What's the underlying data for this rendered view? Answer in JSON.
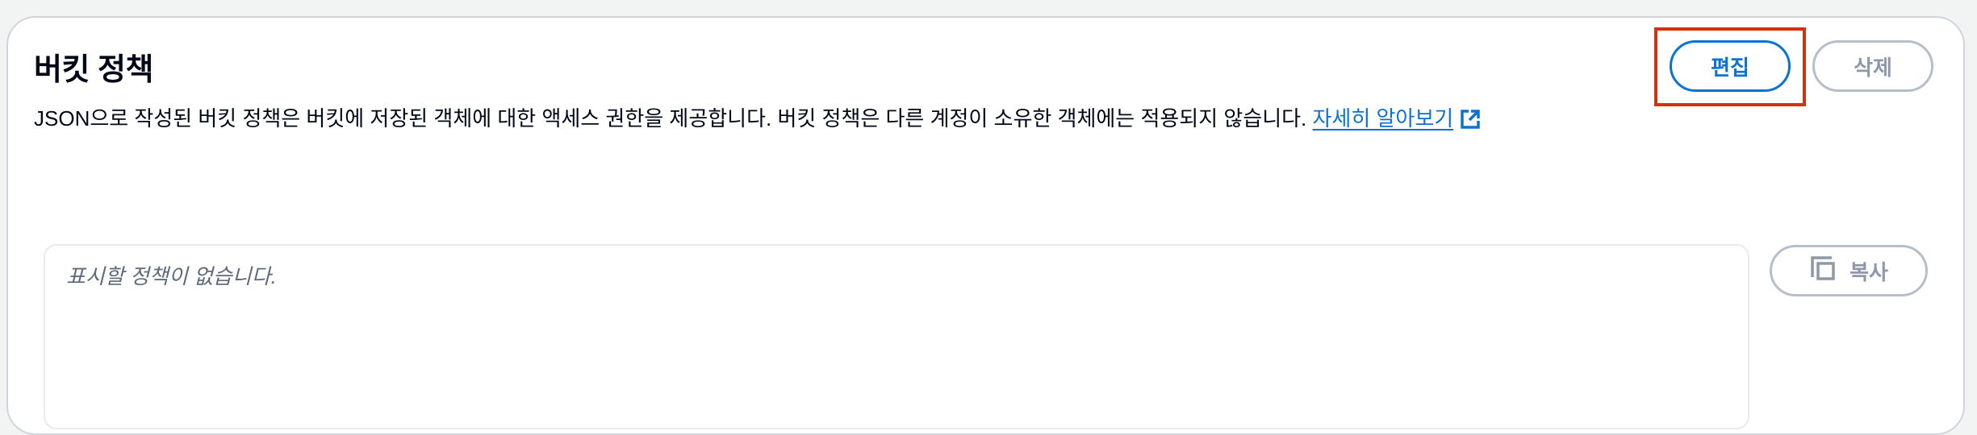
{
  "section": {
    "title": "버킷 정책",
    "description": "JSON으로 작성된 버킷 정책은 버킷에 저장된 객체에 대한 액세스 권한을 제공합니다. 버킷 정책은 다른 계정이 소유한 객체에는 적용되지 않습니다.",
    "learn_more_label": "자세히 알아보기",
    "learn_more_icon": "external-link-icon"
  },
  "actions": {
    "edit_label": "편집",
    "delete_label": "삭제"
  },
  "policy": {
    "empty_text": "표시할 정책이 없습니다.",
    "copy_label": "복사",
    "copy_icon": "copy-icon"
  },
  "colors": {
    "link": "#0972d3",
    "highlight": "#d13212",
    "disabled": "#8d99a8"
  }
}
